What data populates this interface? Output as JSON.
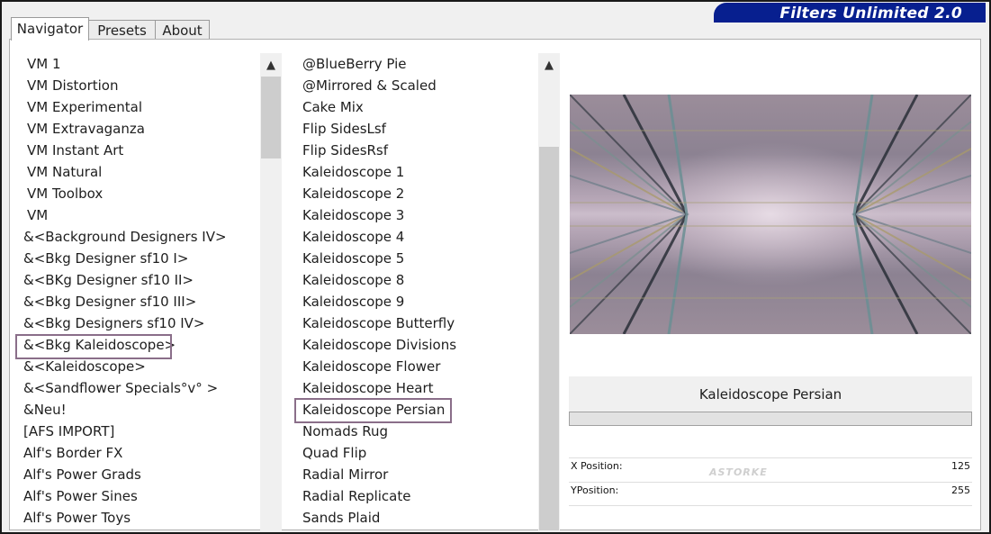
{
  "window": {
    "title": "Filters Unlimited 2.0"
  },
  "tabs": [
    "Navigator",
    "Presets",
    "About"
  ],
  "categories": {
    "items": [
      "VM 1",
      "VM Distortion",
      "VM Experimental",
      "VM Extravaganza",
      "VM Instant Art",
      "VM Natural",
      "VM Toolbox",
      "VM",
      "&<Background Designers IV>",
      "&<Bkg Designer sf10 I>",
      "&<BKg Designer sf10 II>",
      "&<Bkg Designer sf10 III>",
      "&<Bkg Designers sf10 IV>",
      "&<Bkg Kaleidoscope>",
      "&<Kaleidoscope>",
      "&<Sandflower Specials°v° >",
      "&Neu!",
      "[AFS IMPORT]",
      "Alf's Border FX",
      "Alf's Power Grads",
      "Alf's Power Sines",
      "Alf's Power Toys"
    ],
    "selected": "&<Bkg Kaleidoscope>"
  },
  "filters": {
    "items": [
      "@BlueBerry Pie",
      "@Mirrored & Scaled",
      "Cake Mix",
      "Flip SidesLsf",
      "Flip SidesRsf",
      "Kaleidoscope 1",
      "Kaleidoscope 2",
      "Kaleidoscope 3",
      "Kaleidoscope 4",
      "Kaleidoscope 5",
      "Kaleidoscope 8",
      "Kaleidoscope 9",
      "Kaleidoscope Butterfly",
      "Kaleidoscope Divisions",
      "Kaleidoscope Flower",
      "Kaleidoscope Heart",
      "Kaleidoscope Persian",
      "Nomads Rug",
      "Quad Flip",
      "Radial Mirror",
      "Radial Replicate",
      "Sands Plaid"
    ],
    "selected": "Kaleidoscope Persian"
  },
  "preview": {
    "filter_name": "Kaleidoscope Persian"
  },
  "params": [
    {
      "label": "X Position:",
      "value": "125"
    },
    {
      "label": "YPosition:",
      "value": "255"
    }
  ],
  "watermark": "ASTORKE",
  "colors": {
    "banner": "#071f8f",
    "selection_border": "#8a6e89"
  },
  "icons": {
    "scroll_up": "chevron-up-icon"
  }
}
